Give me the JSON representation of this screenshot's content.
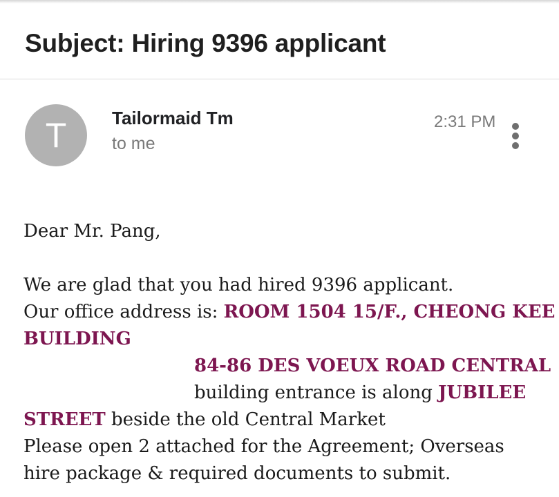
{
  "email": {
    "subject": "Subject: Hiring 9396 applicant",
    "avatar_letter": "T",
    "sender_name": "Tailormaid Tm",
    "recipient": "to me",
    "time": "2:31 PM",
    "greeting": "Dear Mr. Pang,",
    "body": {
      "line1": "We are glad that you had hired 9396 applicant.",
      "line2_prefix": "Our office address is: ",
      "line2_highlight": "ROOM 1504 15/F., CHEONG KEE",
      "line3_highlight": "BUILDING",
      "line4_highlight": "84-86 DES VOEUX ROAD CENTRAL",
      "line5_prefix": "building entrance is along ",
      "line5_highlight": "JUBILEE",
      "line6_highlight": "STREET",
      "line6_suffix": " beside the old Central Market",
      "line7": "Please open 2 attached for the Agreement; Overseas",
      "line8": "hire package & required documents to submit."
    }
  },
  "colors": {
    "highlight": "#7d1650",
    "avatar_bg": "#b2b2b2",
    "muted_text": "#7a7a7a"
  },
  "icons": {
    "more": "more-vertical-icon"
  }
}
